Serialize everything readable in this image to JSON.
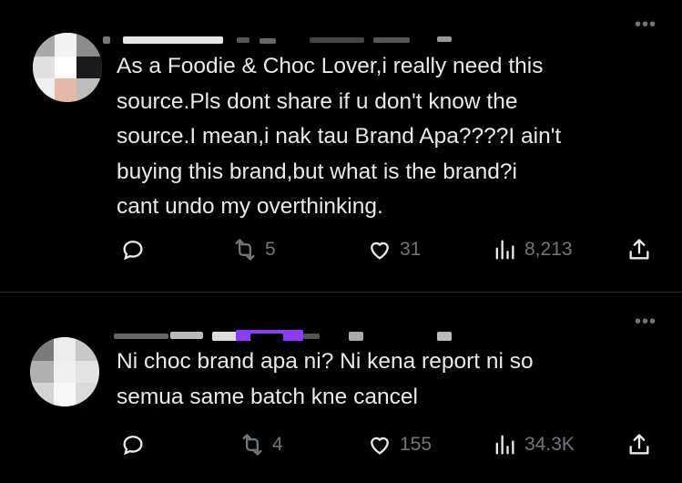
{
  "tweets": [
    {
      "text_lines": [
        "As a Foodie & Choc Lover,i really need this",
        "source.Pls dont share if u don't know the",
        "source.I mean,i nak tau Brand Apa????I ain't",
        "buying this brand,but what is the brand?i",
        "cant undo my overthinking."
      ],
      "reply_count": "",
      "retweet_count": "5",
      "like_count": "31",
      "view_count": "8,213"
    },
    {
      "text_lines": [
        "Ni choc brand apa ni? Ni kena report ni so",
        "semua same batch kne cancel"
      ],
      "reply_count": "",
      "retweet_count": "4",
      "like_count": "155",
      "view_count": "34.3K"
    }
  ],
  "icons": {
    "reply": "reply-icon",
    "retweet": "retweet-icon",
    "like": "heart-icon",
    "views": "views-icon",
    "share": "share-icon",
    "more": "more-icon"
  },
  "colors": {
    "background": "#000000",
    "text": "#e7e9ea",
    "muted": "#71767b",
    "divider": "#2f3336",
    "redacted_purple": "#8b3dff"
  },
  "more_glyph": "•••"
}
